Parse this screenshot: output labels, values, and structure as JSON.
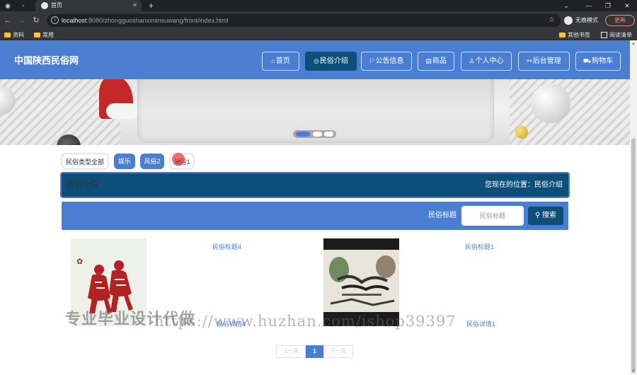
{
  "browser": {
    "tab_title": "首页",
    "url_host": "localhost",
    "url_rest": ":8080/zhongguoshanximinsuwang/front/index.html",
    "incognito_label": "无痕模式",
    "update_label": "更新",
    "bookmarks": [
      "资料",
      "常用"
    ],
    "other_bookmarks": "其他书签",
    "reading_list": "阅读清单"
  },
  "header": {
    "site_title": "中国陕西民俗网",
    "nav": [
      {
        "label": "首页",
        "icon": "home-icon"
      },
      {
        "label": "民俗介绍",
        "icon": "compass-icon"
      },
      {
        "label": "公告信息",
        "icon": "flag-icon"
      },
      {
        "label": "商品",
        "icon": "store-icon"
      },
      {
        "label": "个人中心",
        "icon": "user-icon"
      },
      {
        "label": "后台管理",
        "icon": "link-icon"
      },
      {
        "label": "购物车",
        "icon": "cart-icon"
      }
    ],
    "active_index": 1
  },
  "carousel": {
    "slide_count": 3,
    "active_slide": 0
  },
  "filters": [
    "民俗类型全部",
    "娱乐",
    "风俗2",
    "风俗1"
  ],
  "breadcrumb": {
    "title": "民俗介绍",
    "location_label": "您现在的位置：",
    "location_value": "民俗介绍"
  },
  "search": {
    "label": "民俗标题",
    "placeholder": "民俗标题",
    "button_label": "搜索"
  },
  "cards": [
    {
      "title": "民俗标题4",
      "detail": "民俗详情4"
    },
    {
      "title": "民俗标题1",
      "detail": "民俗详情1"
    }
  ],
  "pagination": {
    "prev": "上一页",
    "current": "1",
    "next": "下一页"
  },
  "watermark": {
    "text": "专业毕业设计代做",
    "url": "https://www.huzhan.com/ishop39397"
  },
  "colors": {
    "primary": "#4a7ed2",
    "dark": "#0e4f7a"
  }
}
